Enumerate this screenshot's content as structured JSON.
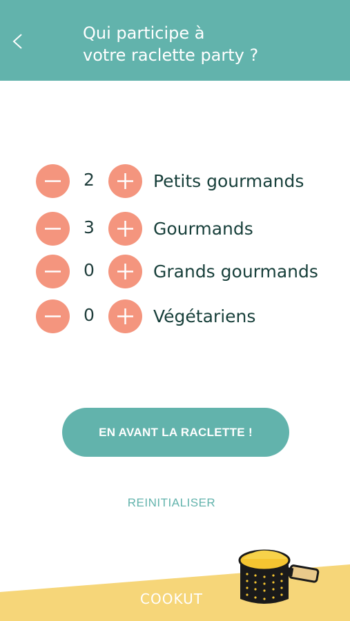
{
  "header": {
    "title_line1": "Qui participe à",
    "title_line2": "votre raclette party ?",
    "back_icon": "chevron-left-icon"
  },
  "counters": [
    {
      "label": "Petits gourmands",
      "count": "2"
    },
    {
      "label": "Gourmands",
      "count": "3"
    },
    {
      "label": "Grands gourmands",
      "count": "0"
    },
    {
      "label": "Végétariens",
      "count": "0"
    }
  ],
  "actions": {
    "cta_label": "EN AVANT LA RACLETTE !",
    "reset_label": "REINITIALISER"
  },
  "footer": {
    "brand": "COOKUT"
  },
  "colors": {
    "header": "#62b3ac",
    "stepper": "#f4957e",
    "text_dark": "#173f3a",
    "footer_yellow": "#f6d679"
  }
}
